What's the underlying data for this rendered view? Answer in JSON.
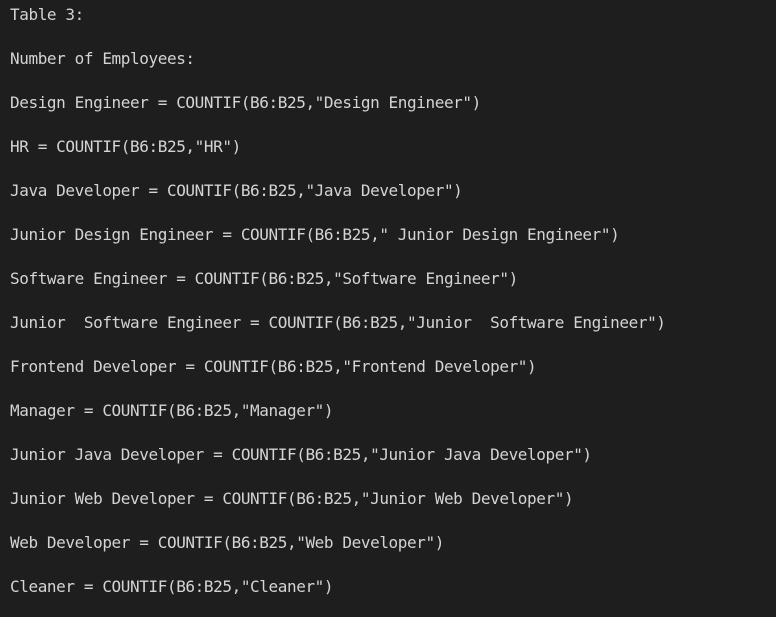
{
  "title": "Table 3:",
  "subtitle": "Number of Employees:",
  "formulas": [
    "Design Engineer = COUNTIF(B6:B25,\"Design Engineer\")",
    "HR = COUNTIF(B6:B25,\"HR\")",
    "Java Developer = COUNTIF(B6:B25,\"Java Developer\")",
    "Junior Design Engineer = COUNTIF(B6:B25,\" Junior Design Engineer\")",
    "Software Engineer = COUNTIF(B6:B25,\"Software Engineer\")",
    "Junior  Software Engineer = COUNTIF(B6:B25,\"Junior  Software Engineer\")",
    "Frontend Developer = COUNTIF(B6:B25,\"Frontend Developer\")",
    "Manager = COUNTIF(B6:B25,\"Manager\")",
    "Junior Java Developer = COUNTIF(B6:B25,\"Junior Java Developer\")",
    "Junior Web Developer = COUNTIF(B6:B25,\"Junior Web Developer\")",
    "Web Developer = COUNTIF(B6:B25,\"Web Developer\")",
    "Cleaner = COUNTIF(B6:B25,\"Cleaner\")"
  ]
}
